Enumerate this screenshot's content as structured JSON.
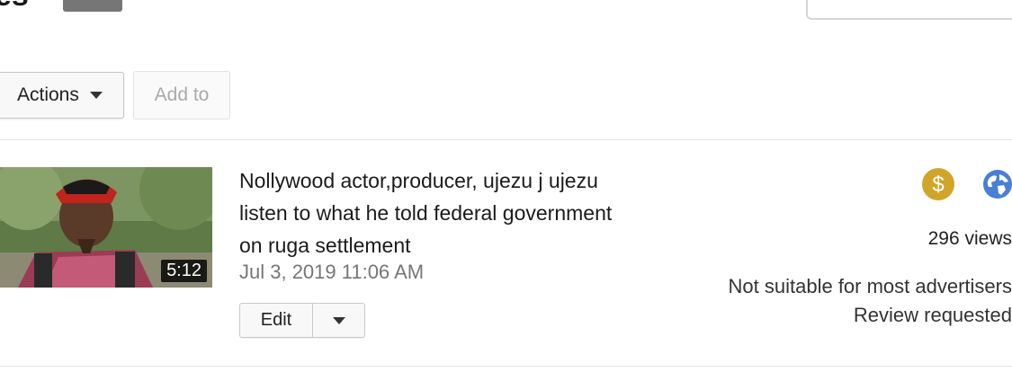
{
  "header": {
    "partial_title": "es"
  },
  "toolbar": {
    "actions_label": "Actions",
    "add_to_label": "Add to"
  },
  "video": {
    "title": "Nollywood actor,producer, ujezu j ujezu listen to what he told federal government on ruga settlement",
    "duration": "5:12",
    "date": "Jul 3, 2019 11:06 AM",
    "edit_label": "Edit",
    "monetization_icon": "dollar-icon",
    "visibility_icon": "globe-icon",
    "views": "296 views",
    "ad_status": "Not suitable for most advertisers",
    "review_status": "Review requested"
  },
  "colors": {
    "monetization": "#d1a52a",
    "visibility": "#4a7fd6"
  }
}
